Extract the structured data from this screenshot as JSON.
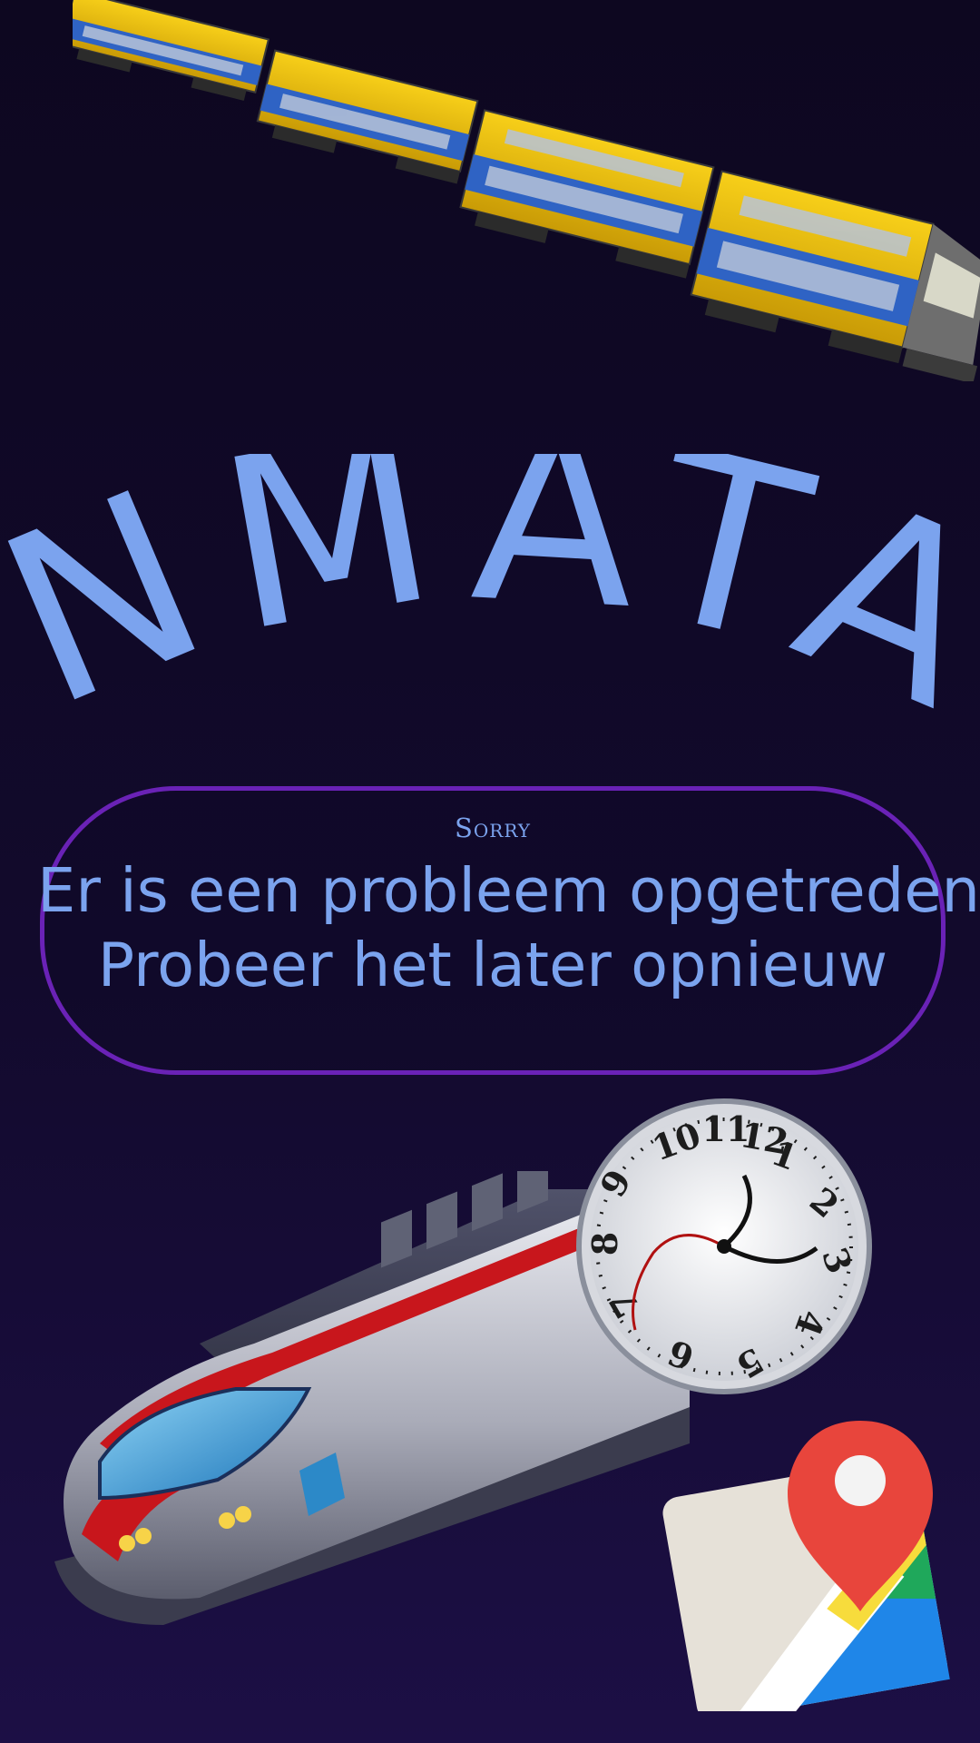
{
  "logo": {
    "text": "NMATA",
    "color": "#7ba3ee"
  },
  "error": {
    "kicker": "Sorry",
    "line1": "Er is een probleem opgetreden",
    "line2": "Probeer het later opnieuw",
    "border_color": "#6a22b6",
    "text_color": "#7ba3ee"
  },
  "illustrations": {
    "top": "double-decker-train-icon",
    "clock": "melting-clock-icon",
    "bottom": "bullet-train-icon",
    "map": "map-pin-icon"
  },
  "colors": {
    "background_top": "#0d0720",
    "background_bottom": "#1c0f45",
    "train_yellow": "#f2c20a",
    "train_blue": "#2f63c4"
  }
}
